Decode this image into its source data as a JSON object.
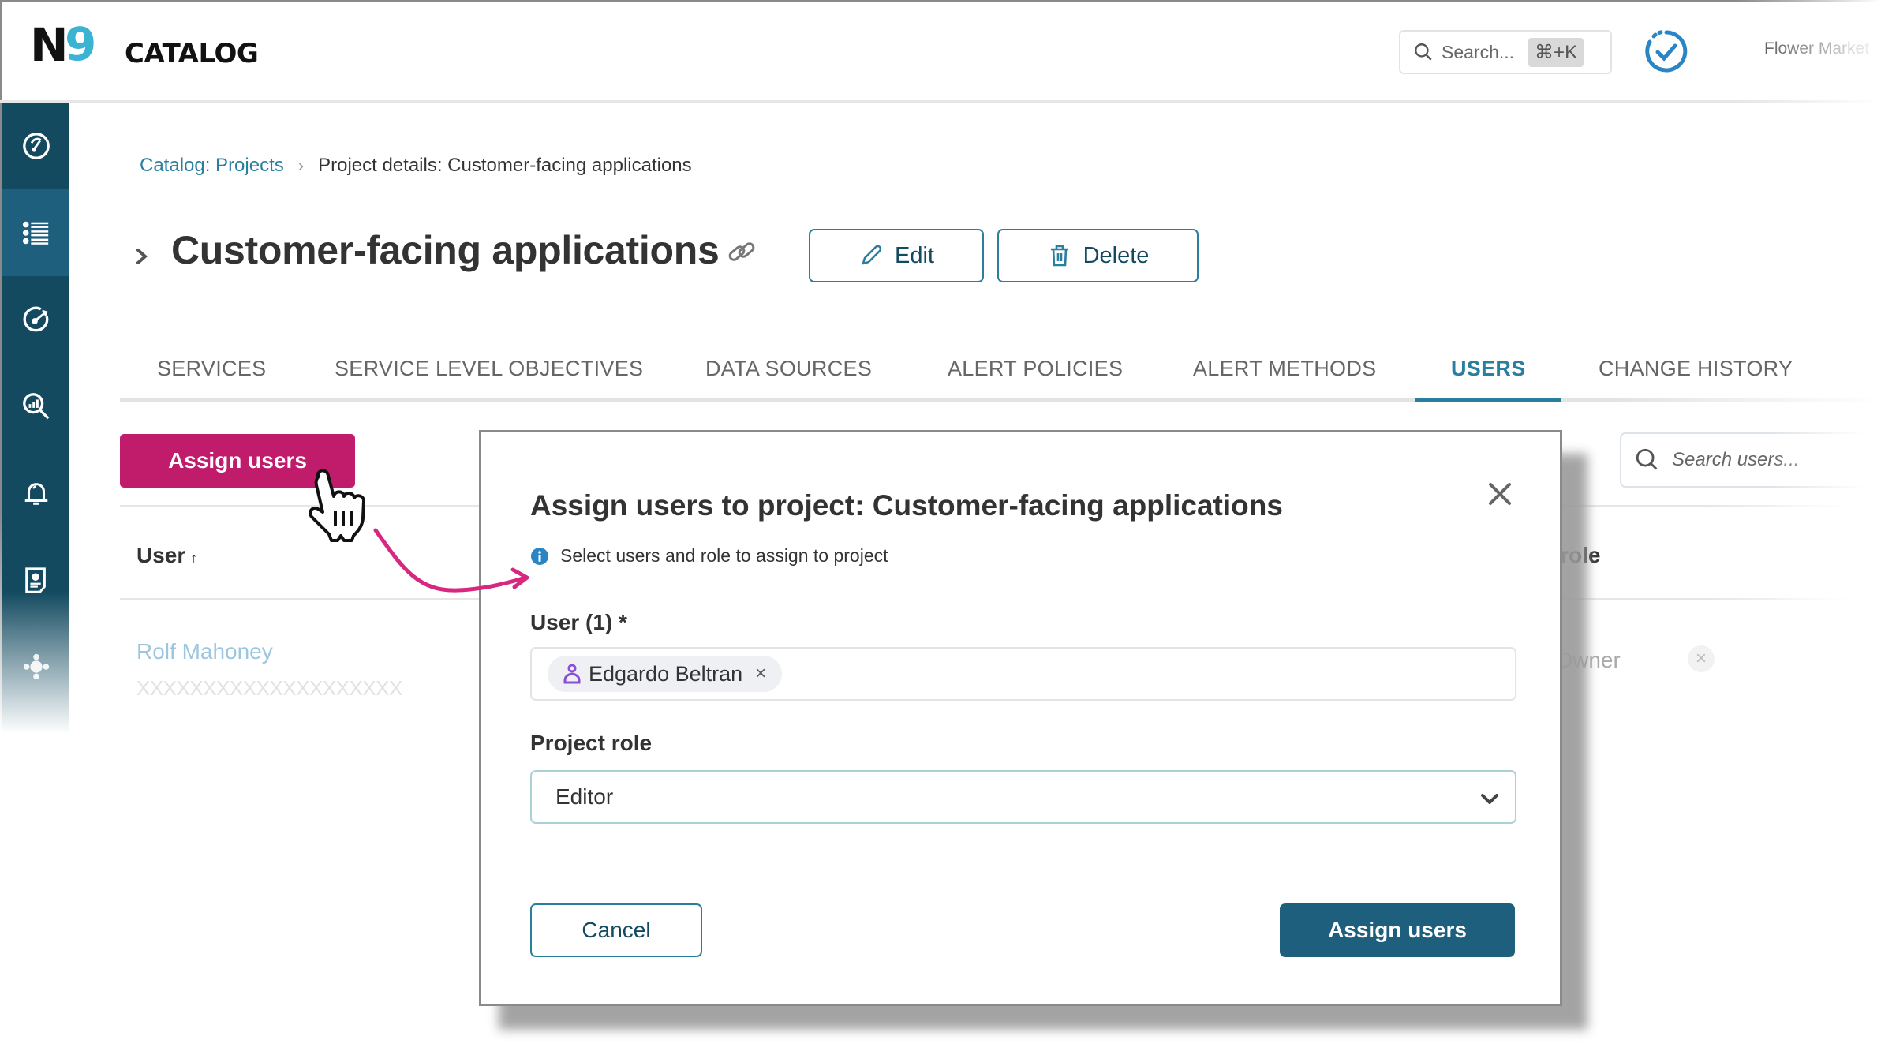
{
  "header": {
    "logo_letter": "N",
    "logo_digit": "9",
    "app_title": "CATALOG",
    "search_placeholder": "Search...",
    "search_shortcut": "⌘+K",
    "org_name": "Flower Market",
    "colors": {
      "logo_accent": "#3ab4d2",
      "status_icon": "#2a85c4"
    }
  },
  "sidebar": {
    "items": [
      {
        "name": "dashboard",
        "icon": "speedometer-icon",
        "active": false
      },
      {
        "name": "catalog",
        "icon": "list-icon",
        "active": true
      },
      {
        "name": "slo",
        "icon": "target-icon",
        "active": false
      },
      {
        "name": "query",
        "icon": "search-chart-icon",
        "active": false
      },
      {
        "name": "alerts",
        "icon": "bell-icon",
        "active": false
      },
      {
        "name": "reports",
        "icon": "report-icon",
        "active": false
      },
      {
        "name": "integrations",
        "icon": "puzzle-icon",
        "active": false
      }
    ],
    "colors": {
      "bg": "#134a60",
      "active_bg": "#1d5f7d"
    }
  },
  "breadcrumb": {
    "parent": "Catalog: Projects",
    "separator": "›",
    "current": "Project details: Customer-facing applications"
  },
  "page": {
    "title": "Customer-facing applications",
    "edit_label": "Edit",
    "delete_label": "Delete"
  },
  "tabs": [
    {
      "label": "SERVICES",
      "active": false
    },
    {
      "label": "SERVICE LEVEL OBJECTIVES",
      "active": false
    },
    {
      "label": "DATA SOURCES",
      "active": false
    },
    {
      "label": "ALERT POLICIES",
      "active": false
    },
    {
      "label": "ALERT METHODS",
      "active": false
    },
    {
      "label": "USERS",
      "active": true
    },
    {
      "label": "CHANGE HISTORY",
      "active": false
    }
  ],
  "users_tab": {
    "assign_button": "Assign users",
    "search_placeholder": "Search users...",
    "columns": {
      "user": "User",
      "user_sort": "↑",
      "role": "Project role",
      "role_visible": ": role"
    },
    "rows": [
      {
        "name": "Rolf Mahoney",
        "email": "XXXXXXXXXXXXXXXXXXXX",
        "role": "Project Owner",
        "role_visible": "ject Owner",
        "remove": "×"
      }
    ],
    "colors": {
      "assign_button": "#c11c6c"
    }
  },
  "modal": {
    "title": "Assign users to project: Customer-facing applications",
    "close": "×",
    "info": "Select users and role to assign to project",
    "user_label": "User (1) *",
    "selected_users": [
      {
        "name": "Edgardo Beltran",
        "remove": "×"
      }
    ],
    "role_label": "Project role",
    "role_value": "Editor",
    "cancel_label": "Cancel",
    "submit_label": "Assign users",
    "colors": {
      "primary": "#1d5f7d",
      "outline": "#2a7f9e",
      "chip_icon": "#8a4fd8"
    }
  },
  "annotation": {
    "cursor": "hand-pointer",
    "arrow_color": "#d8277f"
  }
}
